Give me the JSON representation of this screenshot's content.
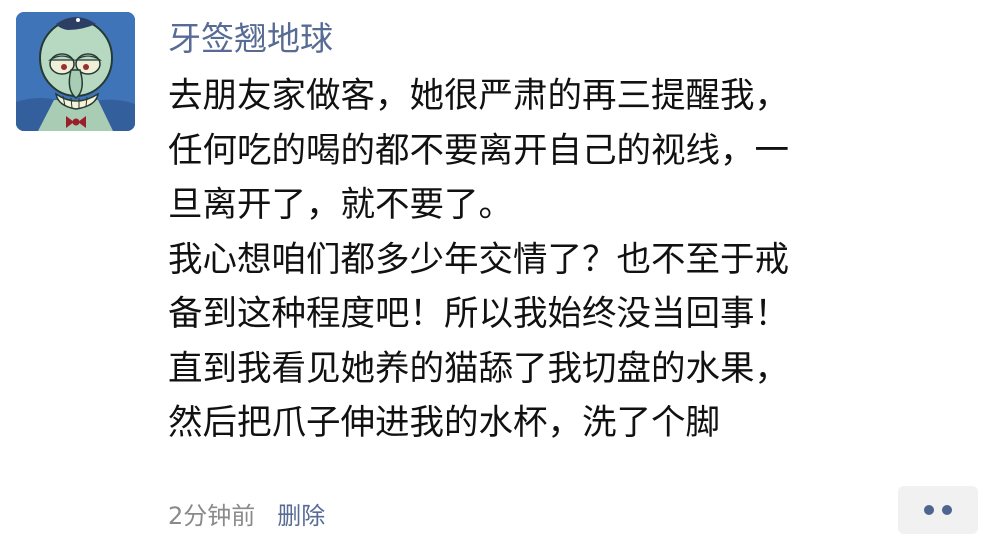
{
  "comment": {
    "avatar_icon": "squidward-avatar",
    "username": "牙签翘地球",
    "lines": [
      "去朋友家做客，她很严肃的再三提醒我，",
      "任何吃的喝的都不要离开自己的视线，一",
      "旦离开了，就不要了。",
      "我心想咱们都多少年交情了？也不至于戒",
      "备到这种程度吧！所以我始终没当回事！",
      "直到我看见她养的猫舔了我切盘的水果，",
      "然后把爪子伸进我的水杯，洗了个脚"
    ],
    "timestamp": "2分钟前",
    "delete_label": "删除",
    "more_icon": "more-dots-icon"
  },
  "colors": {
    "link": "#576b95",
    "text": "#111111",
    "meta": "#8a8a8a",
    "more_button_bg": "#f1f1f1"
  }
}
